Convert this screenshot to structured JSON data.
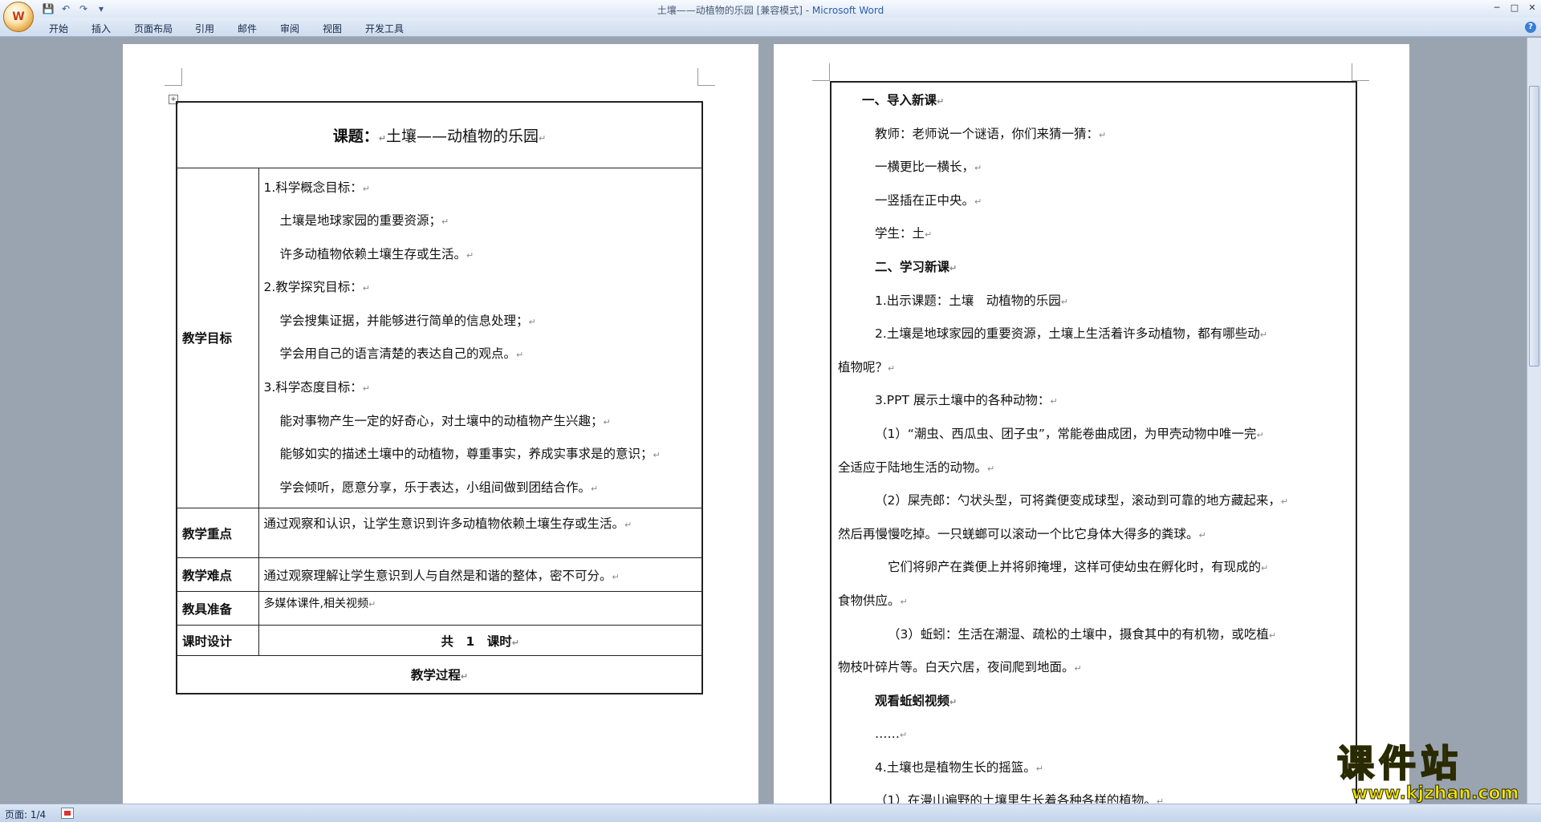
{
  "window": {
    "title_doc": "土壤——动植物的乐园 [兼容模式] - ",
    "title_app": "Microsoft Word"
  },
  "ribbon": {
    "tabs": [
      "开始",
      "插入",
      "页面布局",
      "引用",
      "邮件",
      "审阅",
      "视图",
      "开发工具"
    ]
  },
  "page1": {
    "heading_label": "课题：",
    "heading_value": "土壤——动植物的乐园",
    "goals_label": "教学目标",
    "goals": [
      "1.科学概念目标：",
      "土壤是地球家园的重要资源；",
      "许多动植物依赖土壤生存或生活。",
      "2.教学探究目标：",
      "学会搜集证据，并能够进行简单的信息处理；",
      "学会用自己的语言清楚的表达自己的观点。",
      "3.科学态度目标：",
      "能对事物产生一定的好奇心，对土壤中的动植物产生兴趣；",
      "能够如实的描述土壤中的动植物，尊重事实，养成实事求是的意识；",
      "学会倾听，愿意分享，乐于表达，小组间做到团结合作。"
    ],
    "key_label": "教学重点",
    "key_value": "通过观察和认识，让学生意识到许多动植物依赖土壤生存或生活。",
    "difficulty_label": "教学难点",
    "difficulty_value": "通过观察理解让学生意识到人与自然是和谐的整体，密不可分。",
    "tools_label": "教具准备",
    "tools_value": "多媒体课件,相关视频",
    "hours_label": "课时设计",
    "hours_value": "共　1　课时",
    "process_label": "教学过程"
  },
  "page2": {
    "lines": [
      {
        "text": "一、导入新课",
        "bold": true,
        "indent": 30
      },
      {
        "text": "教师：老师说一个谜语，你们来猜一猜：",
        "bold": false,
        "indent": 46
      },
      {
        "text": "一横更比一横长，",
        "bold": false,
        "indent": 46
      },
      {
        "text": "一竖插在正中央。",
        "bold": false,
        "indent": 46
      },
      {
        "text": "学生：土",
        "bold": false,
        "indent": 46
      },
      {
        "text": "二、学习新课",
        "bold": true,
        "indent": 46
      },
      {
        "text": "1.出示课题：土壤　动植物的乐园",
        "bold": false,
        "indent": 46
      },
      {
        "text": "2.土壤是地球家园的重要资源，土壤上生活着许多动植物，都有哪些动",
        "bold": false,
        "indent": 46
      },
      {
        "text": "植物呢？",
        "bold": false,
        "indent": 0
      },
      {
        "text": "3.PPT 展示土壤中的各种动物：",
        "bold": false,
        "indent": 46
      },
      {
        "text": "（1）“潮虫、西瓜虫、团子虫”，常能卷曲成团，为甲壳动物中唯一完",
        "bold": false,
        "indent": 46
      },
      {
        "text": "全适应于陆地生活的动物。",
        "bold": false,
        "indent": 0
      },
      {
        "text": "（2）屎壳郎：勺状头型，可将粪便变成球型，滚动到可靠的地方藏起来，",
        "bold": false,
        "indent": 46
      },
      {
        "text": "然后再慢慢吃掉。一只蜣螂可以滚动一个比它身体大得多的粪球。",
        "bold": false,
        "indent": 0
      },
      {
        "text": "它们将卵产在粪便上并将卵掩埋，这样可使幼虫在孵化时，有现成的",
        "bold": false,
        "indent": 62
      },
      {
        "text": "食物供应。",
        "bold": false,
        "indent": 0
      },
      {
        "text": "（3）蚯蚓：生活在潮湿、疏松的土壤中，摄食其中的有机物，或吃植",
        "bold": false,
        "indent": 62
      },
      {
        "text": "物枝叶碎片等。白天穴居，夜间爬到地面。",
        "bold": false,
        "indent": 0
      },
      {
        "text": "观看蚯蚓视频",
        "bold": true,
        "indent": 46
      },
      {
        "text": "……",
        "bold": false,
        "indent": 46
      },
      {
        "text": "4.土壤也是植物生长的摇篮。",
        "bold": false,
        "indent": 46
      },
      {
        "text": "（1）在漫山遍野的土壤里生长着各种各样的植物。",
        "bold": false,
        "indent": 46
      }
    ]
  },
  "status": {
    "page": "页面: 1/4"
  },
  "watermark": {
    "main": "课件站",
    "url": "www.kjzhan.com"
  },
  "icons": {
    "office_button": "office-logo-icon",
    "mark": "↵",
    "glyph_save": "💾",
    "glyph_undo": "↶",
    "glyph_redo": "↷",
    "glyph_qa": "▾",
    "glyph_min": "─",
    "glyph_max": "□",
    "glyph_close": "✕",
    "glyph_help": "?"
  }
}
